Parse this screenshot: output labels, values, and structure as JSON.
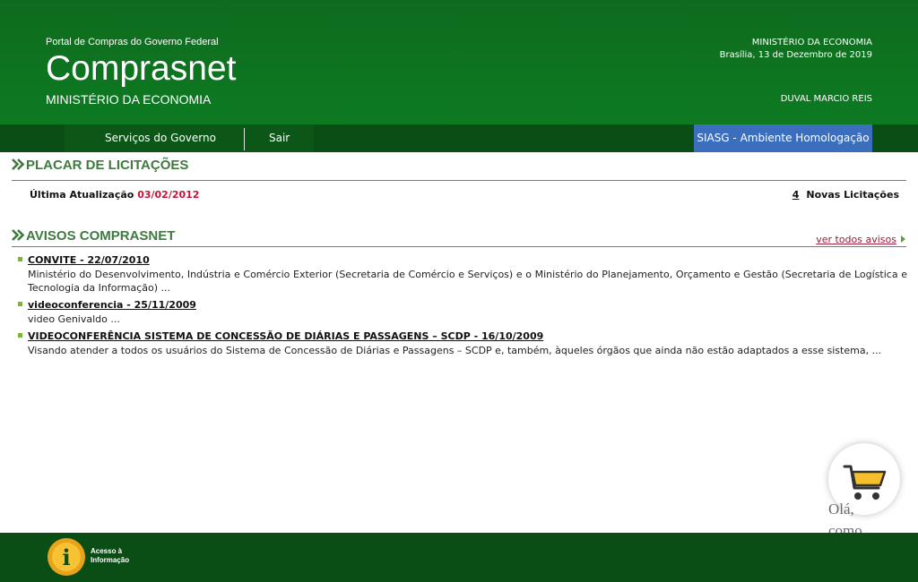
{
  "header": {
    "portal_label": "Portal de Compras do Governo Federal",
    "site_title": "Comprasnet",
    "ministry": "MINISTÉRIO DA ECONOMIA",
    "right_ministry": "MINISTÉRIO DA ECONOMIA",
    "location_date": "Brasília, 13 de Dezembro de 2019",
    "user_name": "DUVAL MARCIO REIS"
  },
  "nav": {
    "items": [
      "Serviços do Governo",
      "Sair"
    ],
    "environment_badge": "SIASG - Ambiente Homologação"
  },
  "placar": {
    "title": "PLACAR DE LICITAÇÕES",
    "last_update_label": "Última Atualização",
    "last_update_date": "03/02/2012",
    "new_count": "4",
    "new_label": "Novas Licitações"
  },
  "avisos": {
    "title": "AVISOS COMPRASNET",
    "see_all": "ver todos avisos",
    "items": [
      {
        "title": "CONVITE - 22/07/2010",
        "description": "Ministério do Desenvolvimento, Indústria e Comércio Exterior (Secretaria de Comércio e Serviços) e o Ministério do Planejamento, Orçamento e Gestão (Secretaria de Logística e Tecnologia da Informação) ..."
      },
      {
        "title": "videoconferencia - 25/11/2009",
        "description": "video Genivaldo ..."
      },
      {
        "title": "VIDEOCONFERÊNCIA SISTEMA DE CONCESSÃO DE DIÁRIAS E PASSAGENS – SCDP - 16/10/2009",
        "description": "Visando atender a todos os usuários do Sistema de Concessão de Diárias e Passagens – SCDP e, também, àqueles órgãos que ainda não estão adaptados a esse sistema, ..."
      }
    ]
  },
  "footer": {
    "acesso_line1": "Acesso à",
    "acesso_line2": "Informação",
    "logo_letter": "i"
  },
  "chat": {
    "icon": "shopping-cart-icon",
    "greeting": "Olá, como"
  },
  "colors": {
    "header_green": "#0d7a22",
    "nav_green": "#0a4d15",
    "badge_blue": "#3b6ebd",
    "date_red": "#c0143c",
    "section_green": "#3f7a3f"
  }
}
